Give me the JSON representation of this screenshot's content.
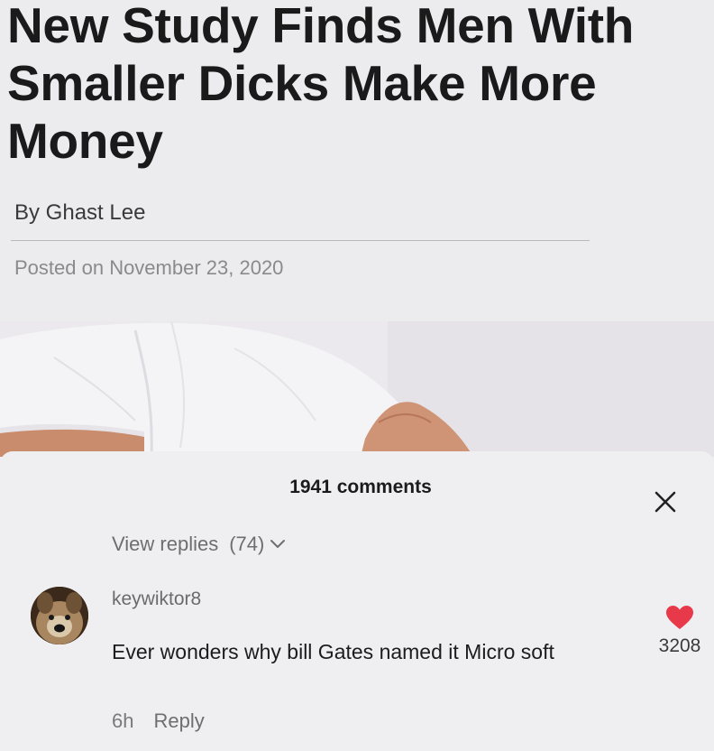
{
  "article": {
    "headline": "New Study Finds Men With Smaller Dicks Make More Money",
    "byline": "By Ghast Lee",
    "posted_on": "Posted on November 23, 2020"
  },
  "comments": {
    "count_label": "1941 comments",
    "view_replies_label": "View replies",
    "view_replies_count": "(74)",
    "comment": {
      "username": "keywiktor8",
      "text": "Ever wonders why bill Gates named it Micro soft",
      "age": "6h",
      "reply_label": "Reply",
      "likes": "3208"
    }
  },
  "icons": {
    "close": "close-icon",
    "chevron": "chevron-down-icon",
    "like": "heart-icon"
  },
  "colors": {
    "like_heart": "#e8394b",
    "headline": "#1a1a1a"
  }
}
